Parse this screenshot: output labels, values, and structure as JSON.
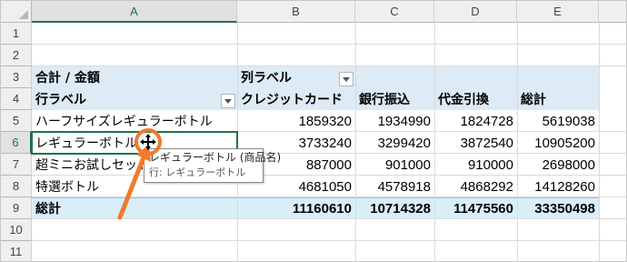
{
  "columns": [
    "A",
    "B",
    "C",
    "D",
    "E"
  ],
  "rows": [
    "1",
    "2",
    "3",
    "4",
    "5",
    "6",
    "7",
    "8",
    "9",
    "10",
    "11"
  ],
  "selected_column": "A",
  "selected_row": "6",
  "pivot": {
    "values_header": "合計 / 金額",
    "column_labels_header": "列ラベル",
    "row_labels_header": "行ラベル",
    "col_headers": [
      "クレジットカード",
      "銀行振込",
      "代金引換",
      "総計"
    ],
    "rows": [
      {
        "label": "ハーフサイズレギュラーボトル",
        "values": [
          "1859320",
          "1934990",
          "1824728",
          "5619038"
        ]
      },
      {
        "label": "レギュラーボトル",
        "values": [
          "3733240",
          "3299420",
          "3872540",
          "10905200"
        ]
      },
      {
        "label": "超ミニお試しセット",
        "values": [
          "887000",
          "901000",
          "910000",
          "2698000"
        ]
      },
      {
        "label": "特選ボトル",
        "values": [
          "4681050",
          "4578918",
          "4868292",
          "14128260"
        ]
      }
    ],
    "grand_total": {
      "label": "総計",
      "values": [
        "11160610",
        "10714328",
        "11475560",
        "33350498"
      ]
    }
  },
  "tooltip": {
    "line1": "レギュラーボトル (商品名)",
    "line2": "行: レギュラーボトル"
  },
  "colors": {
    "pivot_band": "#dcebf6",
    "selection": "#217346",
    "arrow": "#f07a2a"
  }
}
